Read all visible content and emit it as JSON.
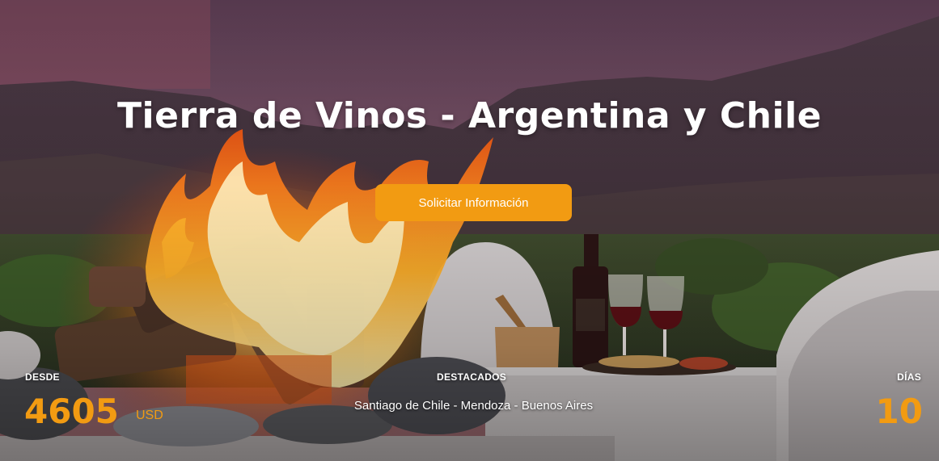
{
  "hero": {
    "title": "Tierra de Vinos - Argentina y Chile",
    "cta_label": "Solicitar Información"
  },
  "details": {
    "price_label": "DESDE",
    "price_value": "4605",
    "price_currency": "USD",
    "highlights_label": "DESTACADOS",
    "highlights_value": "Santiago de Chile - Mendoza - Buenos Aires",
    "days_label": "DÍAS",
    "days_value": "10"
  },
  "colors": {
    "accent": "#f29b12",
    "text": "#ffffff"
  }
}
